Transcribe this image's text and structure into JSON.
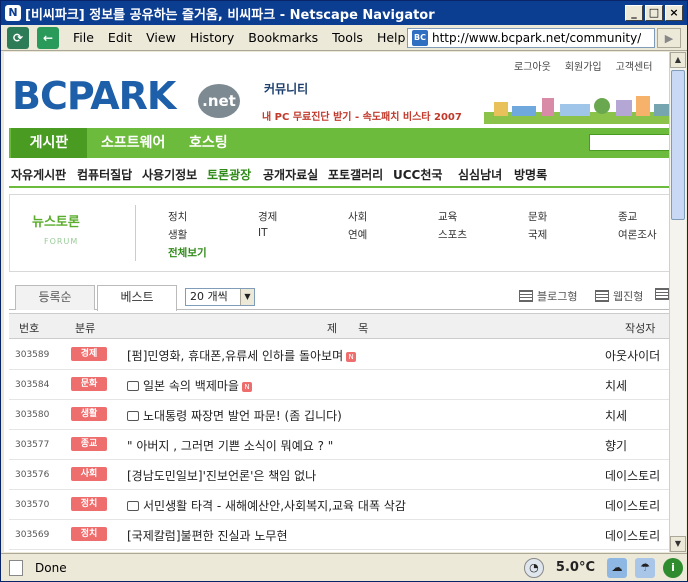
{
  "window": {
    "title": "[비씨파크] 정보를 공유하는 즐거움, 비씨파크 - Netscape Navigator",
    "app_icon": "N"
  },
  "menu": {
    "items": [
      "File",
      "Edit",
      "View",
      "History",
      "Bookmarks",
      "Tools",
      "Help"
    ]
  },
  "address": {
    "badge": "BC",
    "url": "http://www.bcpark.net/community/"
  },
  "status": {
    "text": "Done",
    "temperature": "5.0°C"
  },
  "page": {
    "util_links": [
      "로그아웃",
      "회원가입",
      "고객센터"
    ],
    "logo": "BCPARK",
    "logo_net": ".net",
    "community_label": "커뮤니티",
    "promo": "내 PC 무료진단 받기 - 속도패치 비스타 2007",
    "main_tabs": [
      "게시판",
      "소프트웨어",
      "호스팅"
    ],
    "sub_nav": [
      "자유게시판",
      "컴퓨터질답",
      "사용기정보",
      "토론광장",
      "공개자료실",
      "포토갤러리",
      "UCC천국",
      "심심남녀",
      "방명록"
    ],
    "sub_nav_active": "토론광장",
    "forum_title": "뉴스토론",
    "forum_sub": "FORUM",
    "forum_cats_row1": [
      "정치",
      "경제",
      "사회",
      "교육",
      "문화",
      "종교"
    ],
    "forum_cats_row2": [
      "생활",
      "IT",
      "연예",
      "스포츠",
      "국제",
      "여론조사"
    ],
    "forum_cats_row3": [
      "전체보기"
    ],
    "sort_tabs": [
      "등록순",
      "베스트"
    ],
    "sort_active": "베스트",
    "count_select": "20 개씩",
    "view_blog": "블로그형",
    "view_web": "웹진형",
    "table_head": {
      "num": "번호",
      "cat": "분류",
      "title": "제      목",
      "author": "작성자"
    },
    "rows": [
      {
        "num": "303589",
        "cat": "경제",
        "title": "[펌]민영화, 휴대폰,유류세 인하를 돌아보며",
        "photo": false,
        "new": true,
        "author": "아웃사이더"
      },
      {
        "num": "303584",
        "cat": "문화",
        "title": "일본 속의 백제마을",
        "photo": true,
        "new": true,
        "author": "치세"
      },
      {
        "num": "303580",
        "cat": "생활",
        "title": "노대통령 짜장면 발언 파문! (좀 깁니다)",
        "photo": true,
        "new": false,
        "author": "치세"
      },
      {
        "num": "303577",
        "cat": "종교",
        "title": "\" 아버지 , 그러면 기쁜 소식이 뭐예요 ? \"",
        "photo": false,
        "new": false,
        "author": "향기"
      },
      {
        "num": "303576",
        "cat": "사회",
        "title": "[경남도민일보]'진보언론'은 책임 없나",
        "photo": false,
        "new": false,
        "author": "데이스토리"
      },
      {
        "num": "303570",
        "cat": "정치",
        "title": "서민생활 타격 - 새해예산안,사회복지,교육 대폭 삭감",
        "photo": true,
        "new": false,
        "author": "데이스토리"
      },
      {
        "num": "303569",
        "cat": "정치",
        "title": "[국제칼럼]불편한 진실과 노무현",
        "photo": false,
        "new": false,
        "author": "데이스토리"
      }
    ]
  },
  "colors": {
    "brand_blue": "#1d5fa8",
    "green": "#6dbb3c",
    "category_badge": "#ee6d6d"
  }
}
